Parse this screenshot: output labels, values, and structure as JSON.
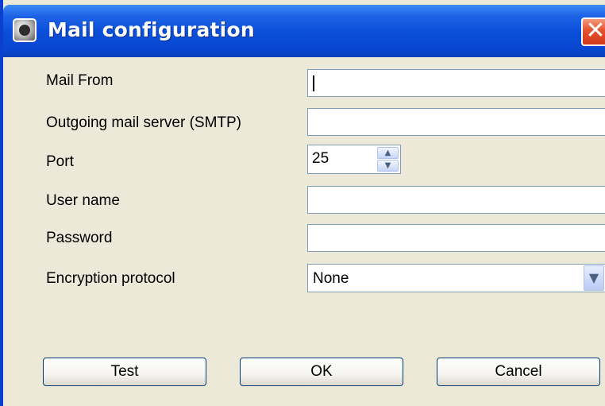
{
  "window": {
    "title": "Mail configuration",
    "close_label": "✕"
  },
  "form": {
    "mail_from": {
      "label": "Mail From",
      "value": ""
    },
    "smtp_server": {
      "label": "Outgoing mail server (SMTP)",
      "value": ""
    },
    "port": {
      "label": "Port",
      "value": "25"
    },
    "user_name": {
      "label": "User name",
      "value": ""
    },
    "password": {
      "label": "Password",
      "value": ""
    },
    "encryption": {
      "label": "Encryption protocol",
      "value": "None"
    }
  },
  "buttons": {
    "test": "Test",
    "ok": "OK",
    "cancel": "Cancel"
  },
  "icons": {
    "app": "mail-app-icon",
    "close": "close-icon",
    "spin_up": "chevron-up-icon",
    "spin_down": "chevron-down-icon",
    "dropdown": "chevron-down-icon"
  },
  "colors": {
    "title_bar": "#0a4ed8",
    "window_bg": "#ece9d8",
    "close_button": "#e5502d",
    "field_border": "#7f9db9"
  }
}
